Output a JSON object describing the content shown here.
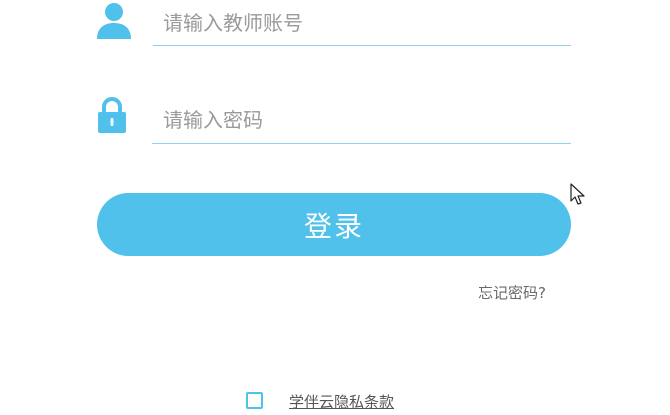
{
  "login": {
    "account_placeholder": "请输入教师账号",
    "account_value": "",
    "password_placeholder": "请输入密码",
    "password_value": "",
    "login_label": "登录",
    "forgot_label": "忘记密码?",
    "privacy_label": "学伴云隐私条款",
    "privacy_checked": false
  },
  "icons": {
    "user": "user-icon",
    "lock": "lock-icon",
    "cursor": "mouse-cursor-icon"
  },
  "colors": {
    "accent": "#4fc1ea",
    "underline": "#8fd0ee",
    "placeholder": "#9a9a9a"
  }
}
